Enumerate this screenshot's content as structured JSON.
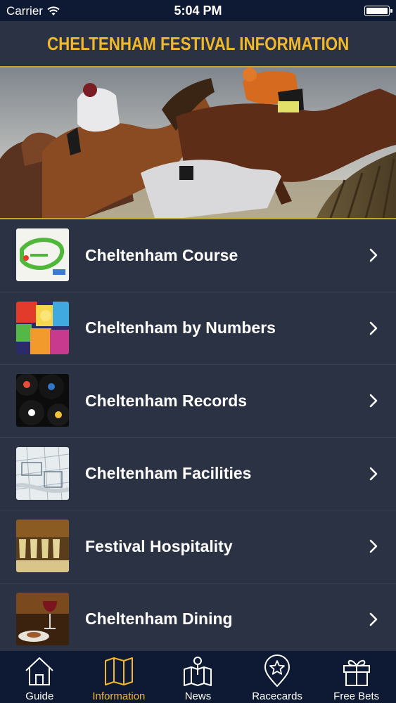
{
  "status_bar": {
    "carrier": "Carrier",
    "time": "5:04 PM",
    "battery_level": 1.0
  },
  "header": {
    "title": "CHELTENHAM FESTIVAL INFORMATION"
  },
  "colors": {
    "accent": "#f0b82a",
    "background": "#2b3243",
    "tab_bar": "#0e1a33",
    "text": "#ffffff"
  },
  "menu": {
    "items": [
      {
        "label": "Cheltenham Course",
        "thumb": "course-map-thumbnail"
      },
      {
        "label": "Cheltenham by Numbers",
        "thumb": "numbers-thumbnail"
      },
      {
        "label": "Cheltenham Records",
        "thumb": "vinyl-records-thumbnail"
      },
      {
        "label": "Cheltenham Facilities",
        "thumb": "blueprint-thumbnail"
      },
      {
        "label": "Festival Hospitality",
        "thumb": "champagne-glasses-thumbnail"
      },
      {
        "label": "Cheltenham Dining",
        "thumb": "wine-dining-thumbnail"
      }
    ]
  },
  "tabs": [
    {
      "label": "Guide",
      "icon": "home-icon",
      "active": false
    },
    {
      "label": "Information",
      "icon": "map-icon",
      "active": true
    },
    {
      "label": "News",
      "icon": "map-pin-icon",
      "active": false
    },
    {
      "label": "Racecards",
      "icon": "star-pin-icon",
      "active": false
    },
    {
      "label": "Free Bets",
      "icon": "gift-icon",
      "active": false
    }
  ]
}
